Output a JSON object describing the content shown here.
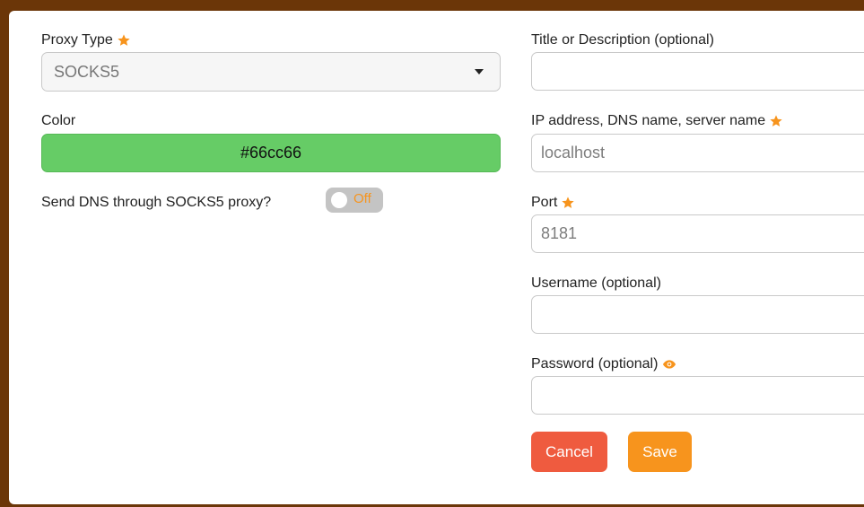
{
  "left": {
    "proxy_type": {
      "label": "Proxy Type",
      "value": "SOCKS5"
    },
    "color": {
      "label": "Color",
      "value": "#66cc66"
    },
    "send_dns": {
      "label": "Send DNS through SOCKS5 proxy?",
      "toggle_text": "Off",
      "enabled": false
    }
  },
  "right": {
    "title": {
      "label": "Title or Description (optional)",
      "value": "",
      "placeholder": ""
    },
    "host": {
      "label": "IP address, DNS name, server name",
      "value": "",
      "placeholder": "localhost"
    },
    "port": {
      "label": "Port",
      "value": "",
      "placeholder": "8181"
    },
    "username": {
      "label": "Username (optional)",
      "value": "",
      "placeholder": ""
    },
    "password": {
      "label": "Password (optional)",
      "value": "",
      "placeholder": ""
    }
  },
  "buttons": {
    "cancel": "Cancel",
    "save": "Save"
  },
  "icons": {
    "required": "star-icon",
    "reveal": "eye-icon"
  },
  "colors": {
    "accent": "#f7941d",
    "cancel": "#ef5b3f",
    "save": "#f7941d",
    "swatch": "#66cc66",
    "toggle_off": "#c4c4c4"
  }
}
